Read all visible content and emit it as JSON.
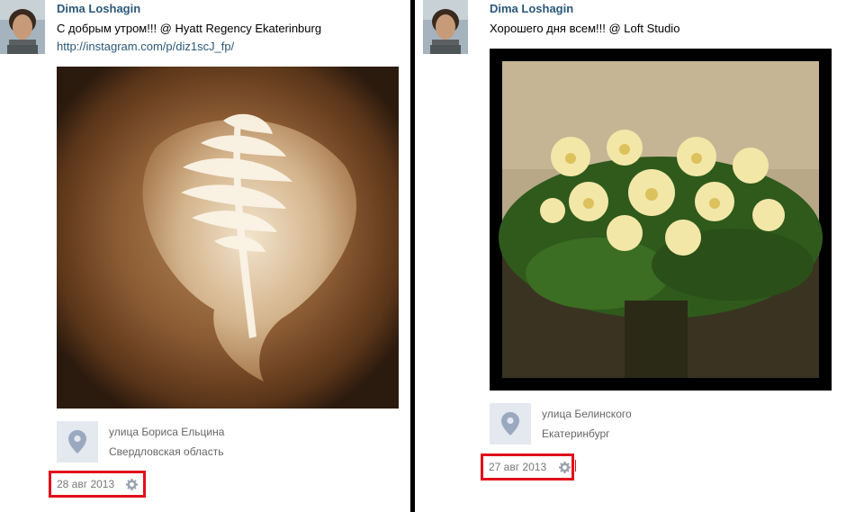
{
  "posts": [
    {
      "author": "Dima Loshagin",
      "text": "С добрым утром!!! @ Hyatt Regency Ekaterinburg",
      "link": "http://instagram.com/p/diz1scJ_fp/",
      "place": {
        "street": "улица Бориса Ельцина",
        "region": "Свердловская область"
      },
      "date": "28 авг 2013",
      "photo_subject": "latte art coffee cup"
    },
    {
      "author": "Dima Loshagin",
      "text": "Хорошего дня всем!!! @ Loft Studio",
      "place": {
        "street": "улица Белинского",
        "region": "Екатеринбург"
      },
      "date": "27 авг 2013",
      "photo_subject": "bouquet of alstroemeria flowers"
    }
  ],
  "colors": {
    "link": "#2b587a",
    "highlight": "#e20e1b",
    "divider": "#000000"
  },
  "icons": [
    "map-pin-icon",
    "gear-icon"
  ]
}
